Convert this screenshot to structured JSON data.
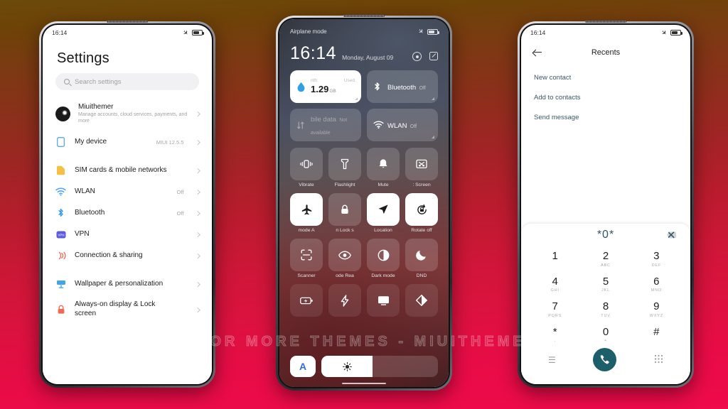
{
  "background": {
    "top_color": "#6b4a0a",
    "bottom_color": "#ef0a4b"
  },
  "watermark": {
    "text": "VISIT FOR MORE THEMES - MIUITHEMER.COM"
  },
  "phone_left": {
    "statusbar": {
      "time": "16:14",
      "airplane_icon": "airplane-icon",
      "battery_icon": "battery-icon"
    },
    "title": "Settings",
    "search": {
      "placeholder": "Search settings",
      "icon": "search-icon"
    },
    "account": {
      "name": "Miuithemer",
      "subtitle": "Manage accounts, cloud services, payments, and more",
      "avatar": "avatar"
    },
    "items": [
      {
        "label": "My device",
        "value": "MIUI 12.5.5",
        "icon": "phone-icon",
        "color": "#5aa7f0",
        "gap": false
      },
      {
        "label": "SIM cards & mobile networks",
        "value": "",
        "icon": "sim-icon",
        "color": "#f5c144",
        "gap": true
      },
      {
        "label": "WLAN",
        "value": "Off",
        "icon": "wifi-icon",
        "color": "#4aa3ef",
        "gap": false
      },
      {
        "label": "Bluetooth",
        "value": "Off",
        "icon": "bluetooth-icon",
        "color": "#2f9af0",
        "gap": false
      },
      {
        "label": "VPN",
        "value": "",
        "icon": "vpn-icon",
        "color": "#5b5bdd",
        "gap": false
      },
      {
        "label": "Connection & sharing",
        "value": "",
        "icon": "connection-sharing-icon",
        "color": "#ef6a53",
        "gap": false
      },
      {
        "label": "Wallpaper & personalization",
        "value": "",
        "icon": "wallpaper-icon",
        "color": "#41a5e8",
        "gap": true
      },
      {
        "label": "Always-on display & Lock screen",
        "value": "",
        "icon": "lock-icon",
        "color": "#ef6a53",
        "gap": false
      }
    ]
  },
  "phone_center": {
    "statusbar": {
      "label": "Airplane mode",
      "airplane_icon": "airplane-icon",
      "battery_icon": "battery-icon"
    },
    "clock": {
      "time": "16:14",
      "date": "Monday, August 09"
    },
    "header_icons": [
      {
        "name": "camera-icon"
      },
      {
        "name": "edit-icon"
      }
    ],
    "big_tiles": [
      {
        "name": "data-usage-tile",
        "state": "on",
        "top_left": "nth",
        "top_right": "Used",
        "amount": "1.29",
        "unit": "GB",
        "icon": "water-drop-icon"
      },
      {
        "name": "bluetooth-tile",
        "state": "off",
        "label": "Bluetooth",
        "sub": "Off",
        "icon": "bluetooth-icon"
      },
      {
        "name": "mobile-data-tile",
        "state": "unavailable",
        "label": "bile data",
        "sub": "Not available",
        "icon": "data-transfer-icon"
      },
      {
        "name": "wlan-tile",
        "state": "off",
        "label": "WLAN",
        "sub": "Off",
        "icon": "wifi-icon"
      }
    ],
    "toggles": [
      {
        "label": "Vibrate",
        "icon": "vibrate-icon",
        "state": "off"
      },
      {
        "label": "Flashlight",
        "icon": "flashlight-icon",
        "state": "off"
      },
      {
        "label": "Mute",
        "icon": "bell-icon",
        "state": "off"
      },
      {
        "label": ":  Screen",
        "icon": "cast-screen-icon",
        "state": "off"
      },
      {
        "label": "mode    A",
        "icon": "airplane-icon",
        "state": "on"
      },
      {
        "label": "n    Lock s",
        "icon": "lock-icon",
        "state": "off"
      },
      {
        "label": "Location",
        "icon": "location-icon",
        "state": "on"
      },
      {
        "label": "Rotate off",
        "icon": "rotate-icon",
        "state": "on"
      },
      {
        "label": "Scanner",
        "icon": "scanner-icon",
        "state": "off"
      },
      {
        "label": "ode    Rea",
        "icon": "eye-icon",
        "state": "off"
      },
      {
        "label": "Dark mode",
        "icon": "contrast-icon",
        "state": "off"
      },
      {
        "label": "DND",
        "icon": "moon-icon",
        "state": "off"
      },
      {
        "label": "",
        "icon": "battery-saver-icon",
        "state": "faint"
      },
      {
        "label": "",
        "icon": "lightning-icon",
        "state": "faint"
      },
      {
        "label": "",
        "icon": "screenshot-icon",
        "state": "faint"
      },
      {
        "label": "",
        "icon": "theme-icon",
        "state": "faint"
      }
    ],
    "bottom": {
      "font_button": "A",
      "brightness_icon": "brightness-icon",
      "brightness_percent": 44
    }
  },
  "phone_right": {
    "statusbar": {
      "time": "16:14",
      "airplane_icon": "airplane-icon",
      "battery_icon": "battery-icon"
    },
    "title": "Recents",
    "back_icon": "back-arrow-icon",
    "options": [
      "New contact",
      "Add to contacts",
      "Send message"
    ],
    "dialer": {
      "number": "*0*",
      "backspace_icon": "backspace-icon",
      "keys": [
        {
          "digit": "1",
          "letters": ""
        },
        {
          "digit": "2",
          "letters": "ABC"
        },
        {
          "digit": "3",
          "letters": "DEF"
        },
        {
          "digit": "4",
          "letters": "GHI"
        },
        {
          "digit": "5",
          "letters": "JKL"
        },
        {
          "digit": "6",
          "letters": "MNO"
        },
        {
          "digit": "7",
          "letters": "PQRS"
        },
        {
          "digit": "8",
          "letters": "TUV"
        },
        {
          "digit": "9",
          "letters": "WXYZ"
        },
        {
          "digit": "*",
          "letters": ","
        },
        {
          "digit": "0",
          "letters": "+"
        },
        {
          "digit": "#",
          "letters": ""
        }
      ],
      "nav": {
        "menu_icon": "menu-icon",
        "call_icon": "call-icon",
        "keypad_icon": "keypad-icon"
      },
      "call_button_color": "#1d5e6b"
    }
  }
}
